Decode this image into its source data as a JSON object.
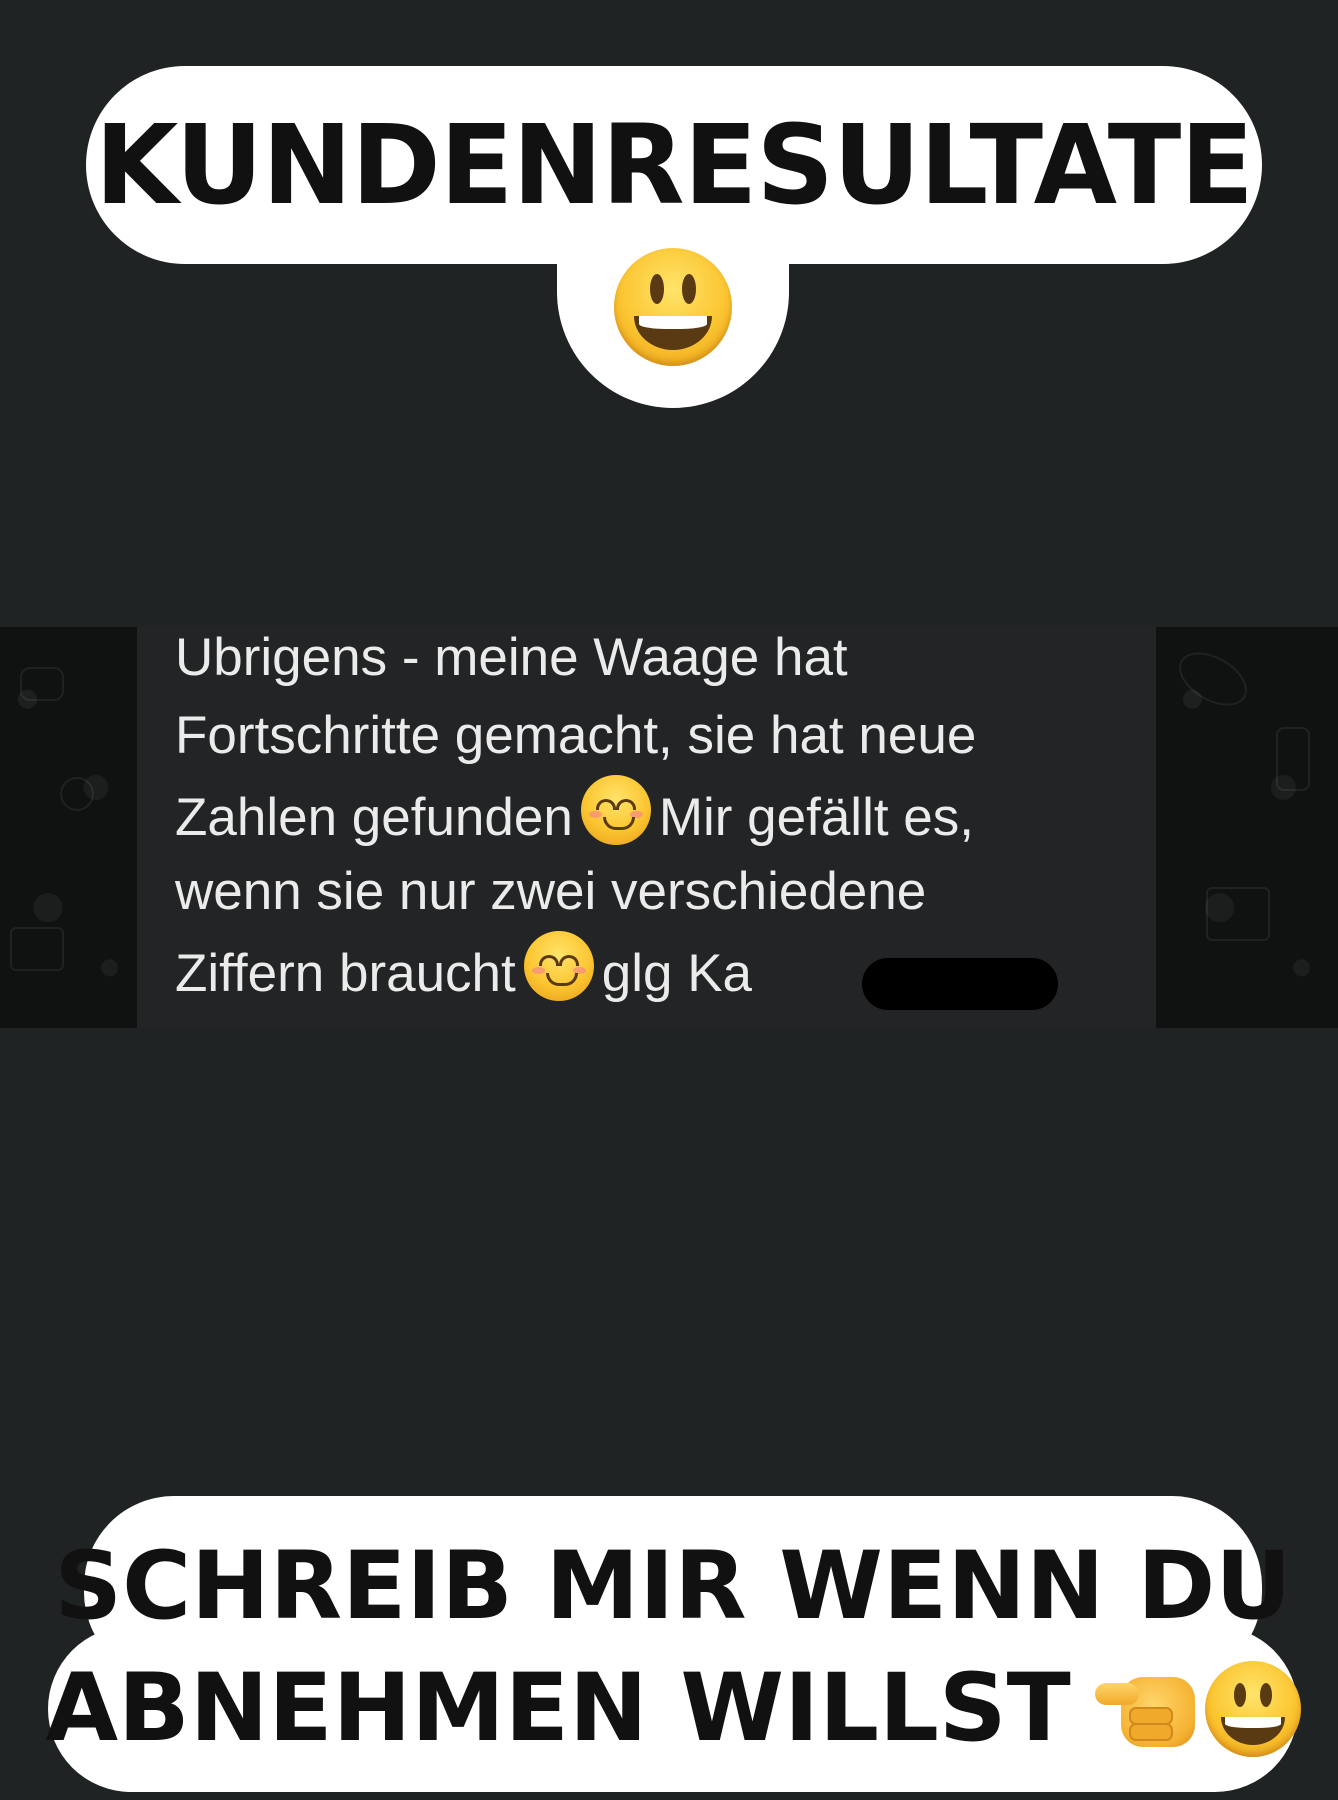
{
  "header": {
    "title": "KUNDENRESULTATE",
    "emoji": "grinning-face-icon"
  },
  "message": {
    "lines": [
      "Ubrigens - meine Waage hat",
      "Fortschritte gemacht, sie hat neue",
      "Zahlen gefunden",
      "Mir gefällt es,",
      "wenn sie nur zwei verschiedene",
      "Ziffern braucht",
      "glg Ka"
    ],
    "emoji": "smiling-face-with-smiling-eyes-icon",
    "redacted": true
  },
  "cta": {
    "line1": "SCHREIB MIR WENN DU",
    "line2": "ABNEHMEN WILLST",
    "emojis": [
      "pointing-hand-icon",
      "grinning-face-icon"
    ]
  },
  "colors": {
    "background": "#202324",
    "bubble": "#222425",
    "pill": "#ffffff",
    "text_dark": "#111111",
    "text_light": "#ebebeb"
  }
}
